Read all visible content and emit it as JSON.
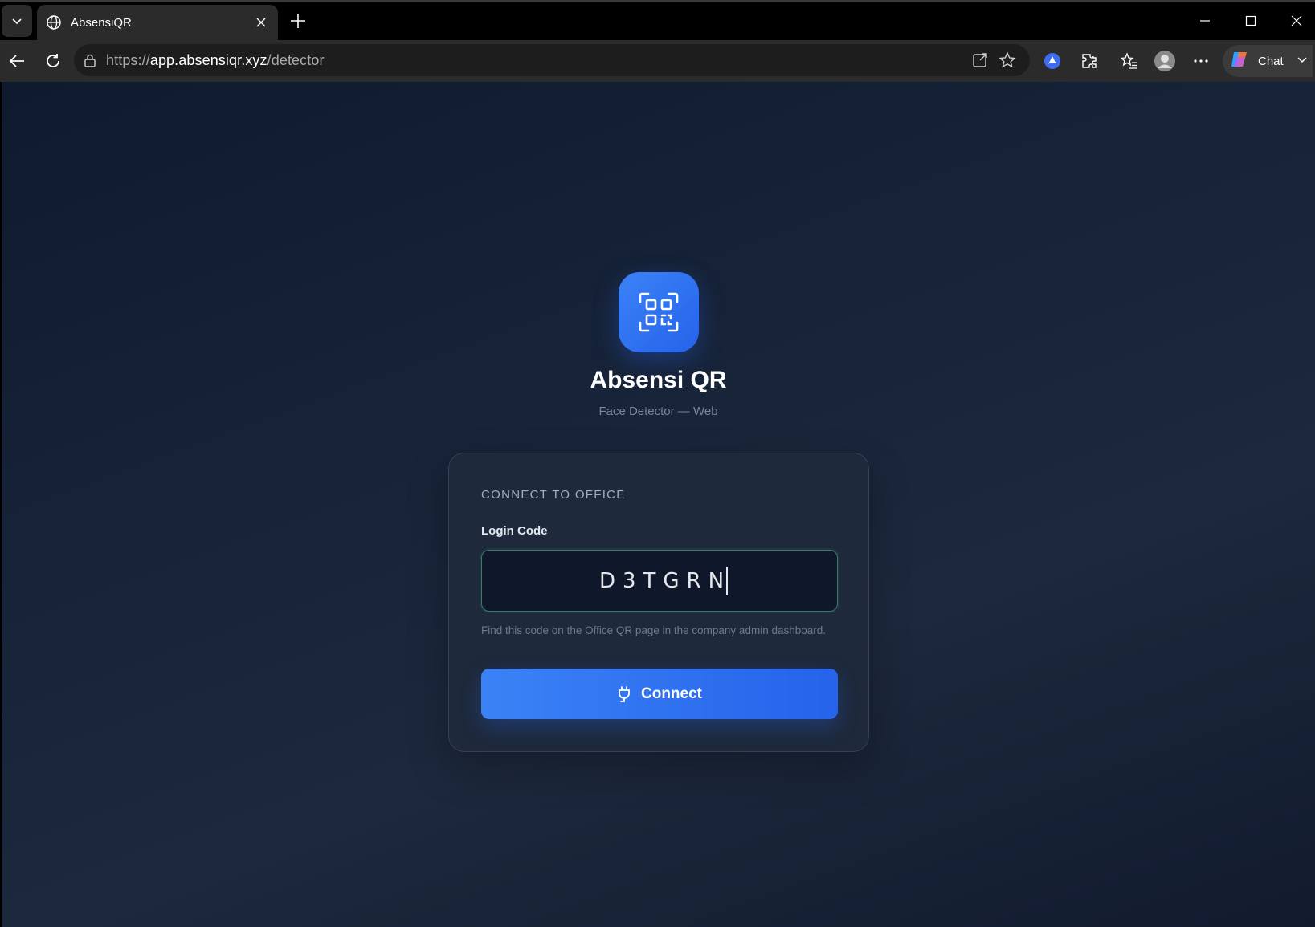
{
  "browser": {
    "tab_title": "AbsensiQR",
    "url_scheme": "https://",
    "url_host": "app.absensiqr.xyz",
    "url_path": "/detector",
    "chat_label": "Chat"
  },
  "app": {
    "title": "Absensi QR",
    "subtitle": "Face Detector — Web"
  },
  "card": {
    "heading": "CONNECT TO OFFICE",
    "field_label": "Login Code",
    "code_value": "D3TGRN",
    "hint": "Find this code on the Office QR page in the company admin dashboard.",
    "button_label": "Connect"
  },
  "colors": {
    "accent": "#3b82f6",
    "background": "#162237",
    "card": "#1e293b"
  }
}
